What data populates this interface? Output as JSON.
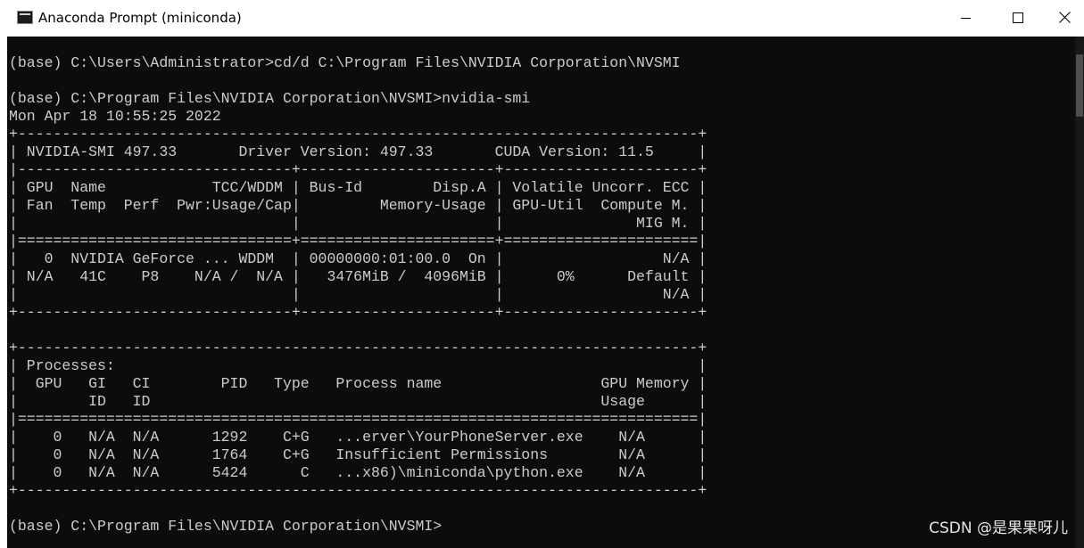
{
  "window": {
    "title": "Anaconda Prompt (miniconda)",
    "icon": "console-icon"
  },
  "console": {
    "lines": [
      "(base) C:\\Users\\Administrator>cd/d C:\\Program Files\\NVIDIA Corporation\\NVSMI",
      "",
      "(base) C:\\Program Files\\NVIDIA Corporation\\NVSMI>nvidia-smi",
      "Mon Apr 18 10:55:25 2022",
      "+-----------------------------------------------------------------------------+",
      "| NVIDIA-SMI 497.33       Driver Version: 497.33       CUDA Version: 11.5     |",
      "|-------------------------------+----------------------+----------------------+",
      "| GPU  Name            TCC/WDDM | Bus-Id        Disp.A | Volatile Uncorr. ECC |",
      "| Fan  Temp  Perf  Pwr:Usage/Cap|         Memory-Usage | GPU-Util  Compute M. |",
      "|                               |                      |               MIG M. |",
      "|===============================+======================+======================|",
      "|   0  NVIDIA GeForce ... WDDM  | 00000000:01:00.0  On |                  N/A |",
      "| N/A   41C    P8    N/A /  N/A |   3476MiB /  4096MiB |      0%      Default |",
      "|                               |                      |                  N/A |",
      "+-------------------------------+----------------------+----------------------+",
      "",
      "+-----------------------------------------------------------------------------+",
      "| Processes:                                                                  |",
      "|  GPU   GI   CI        PID   Type   Process name                  GPU Memory |",
      "|        ID   ID                                                   Usage      |",
      "|=============================================================================|",
      "|    0   N/A  N/A      1292    C+G   ...erver\\YourPhoneServer.exe    N/A      |",
      "|    0   N/A  N/A      1764    C+G   Insufficient Permissions        N/A      |",
      "|    0   N/A  N/A      5424      C   ...x86)\\miniconda\\python.exe    N/A      |",
      "+-----------------------------------------------------------------------------+",
      "",
      "(base) C:\\Program Files\\NVIDIA Corporation\\NVSMI>"
    ]
  },
  "watermark": {
    "text": "CSDN @是果果呀儿"
  }
}
